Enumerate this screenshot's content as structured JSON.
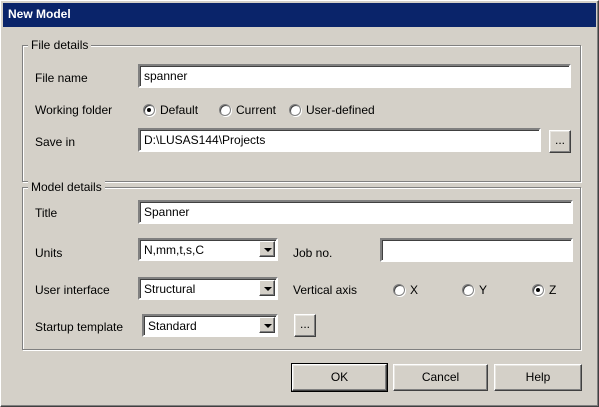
{
  "dialog": {
    "title": "New Model",
    "file_details": {
      "legend": "File details",
      "file_name_label": "File name",
      "file_name_value": "spanner",
      "working_folder_label": "Working folder",
      "working_folder_options": [
        "Default",
        "Current",
        "User-defined"
      ],
      "working_folder_selected": "Default",
      "save_in_label": "Save in",
      "save_in_value": "D:\\LUSAS144\\Projects",
      "browse_label": "..."
    },
    "model_details": {
      "legend": "Model details",
      "title_label": "Title",
      "title_value": "Spanner",
      "units_label": "Units",
      "units_value": "N,mm,t,s,C",
      "job_no_label": "Job no.",
      "job_no_value": "",
      "user_interface_label": "User interface",
      "user_interface_value": "Structural",
      "vertical_axis_label": "Vertical axis",
      "vertical_axis_options": [
        "X",
        "Y",
        "Z"
      ],
      "vertical_axis_selected": "Z",
      "startup_template_label": "Startup template",
      "startup_template_value": "Standard",
      "template_browse_label": "..."
    },
    "buttons": {
      "ok": "OK",
      "cancel": "Cancel",
      "help": "Help"
    }
  }
}
